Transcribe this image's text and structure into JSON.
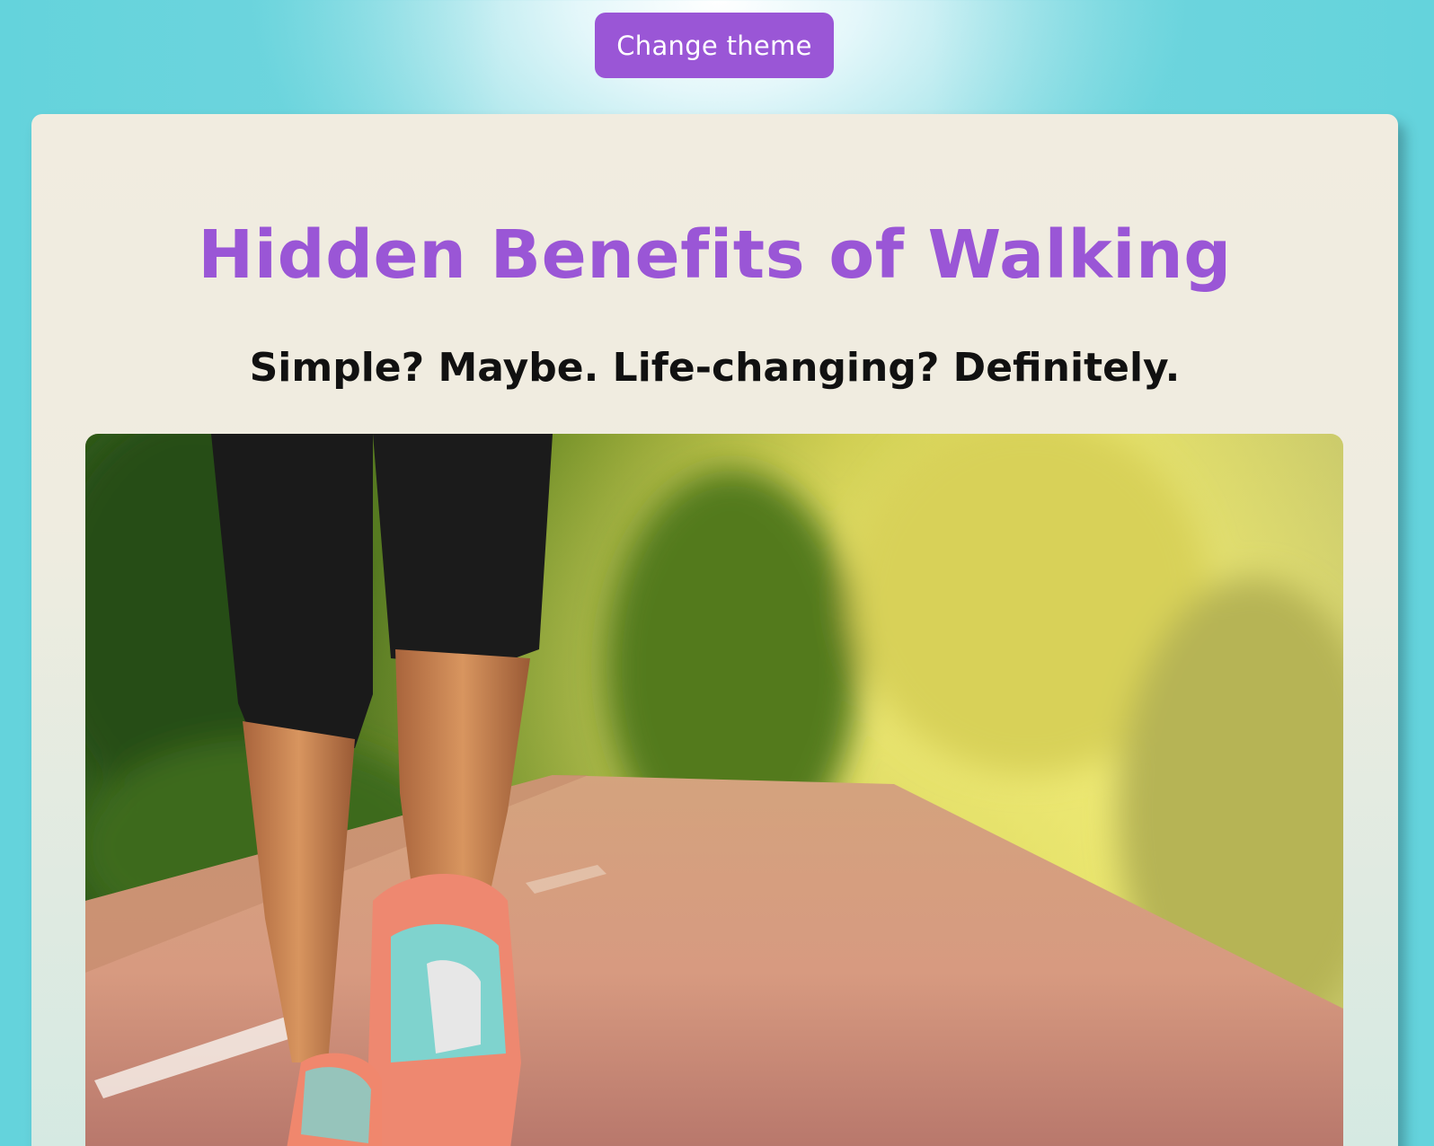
{
  "header": {
    "change_theme_label": "Change theme"
  },
  "article": {
    "title": "Hidden Benefits of Walking",
    "subtitle": "Simple? Maybe. Life-changing? Definitely.",
    "image_alt": "walking legs with running shoes on a tree-lined path"
  },
  "colors": {
    "accent": "#9a56d6",
    "background": "#72d6de",
    "card": "#f1ece0"
  }
}
